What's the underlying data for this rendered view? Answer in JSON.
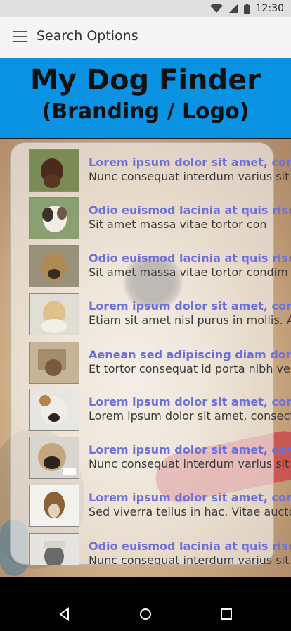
{
  "status_bar": {
    "time": "12:30",
    "icons": [
      "wifi-icon",
      "signal-icon",
      "battery-icon"
    ]
  },
  "app_bar": {
    "title": "Search Options",
    "menu_icon": "hamburger-menu-icon"
  },
  "banner": {
    "title": "My Dog Finder",
    "subtitle": "(Branding / Logo)",
    "background_color": "#0b93e3"
  },
  "accent": {
    "item_title_color": "#6f6fd8"
  },
  "dogs": [
    {
      "title": "Lorem ipsum dolor sit amet, con",
      "subtitle": "Nunc consequat interdum varius sit a"
    },
    {
      "title": "Odio euismod lacinia at quis risus.",
      "subtitle": "Sit amet massa vitae tortor con"
    },
    {
      "title": "Odio euismod lacinia at quis risu",
      "subtitle": "Sit amet massa vitae tortor condim"
    },
    {
      "title": "Lorem ipsum dolor sit amet, conse",
      "subtitle": "Etiam sit amet nisl purus in mollis. Ac"
    },
    {
      "title": "Aenean sed adipiscing diam donec",
      "subtitle": "Et tortor consequat id porta nibh ver"
    },
    {
      "title": "Lorem ipsum dolor sit amet, conse",
      "subtitle": "Lorem ipsum dolor sit amet, consect"
    },
    {
      "title": "Lorem ipsum dolor sit amet, conse",
      "subtitle": "Nunc consequat interdum varius sit a"
    },
    {
      "title": "Lorem ipsum dolor sit amet, conse",
      "subtitle": "Sed viverra tellus in hac. Vitae auctor"
    },
    {
      "title": "Odio euismod lacinia at quis risus.",
      "subtitle": "Nunc consequat interdum varius sit a"
    }
  ],
  "nav_bar": {
    "buttons": [
      "back-icon",
      "home-icon",
      "recents-icon"
    ]
  }
}
